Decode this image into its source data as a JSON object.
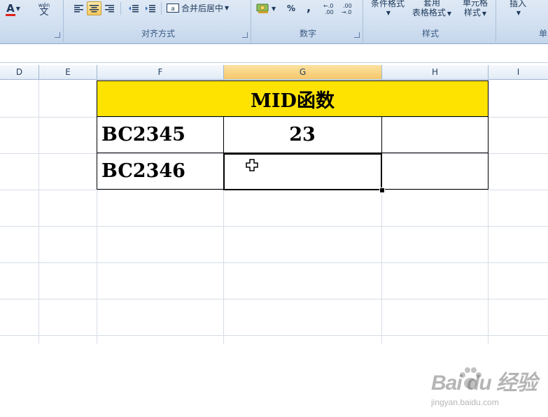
{
  "ribbon": {
    "font_group": {
      "font_color_label": "A",
      "phonetic_label_top": "wén",
      "phonetic_label_bottom": "文"
    },
    "alignment_group": {
      "label": "对齐方式",
      "merge_center_label": "合并后居中"
    },
    "number_group": {
      "label": "数字",
      "percent_label": "%",
      "comma_label": ",",
      "increase_decimal_label": "+.0\n.00",
      "decrease_decimal_label": ".00\n→.0"
    },
    "styles_group": {
      "label": "样式",
      "conditional_format_label": "条件格式",
      "table_format_top": "套用",
      "table_format_label": "表格格式",
      "cell_styles_top": "单元格",
      "cell_styles_label": "样式"
    },
    "cells_group": {
      "insert_label": "插入",
      "partial_label": "单"
    },
    "accent_color": "#f8c95d"
  },
  "columns": {
    "D": "D",
    "E": "E",
    "F": "F",
    "G": "G",
    "H": "H",
    "I": "I"
  },
  "sheet": {
    "title": "MID函数",
    "rows": [
      {
        "code": "BC2345",
        "result": "23"
      },
      {
        "code": "BC2346",
        "result": ""
      }
    ],
    "title_fill_color": "#ffe300"
  },
  "watermark": {
    "brand": "Bai du 经验",
    "url": "jingyan.baidu.com"
  }
}
